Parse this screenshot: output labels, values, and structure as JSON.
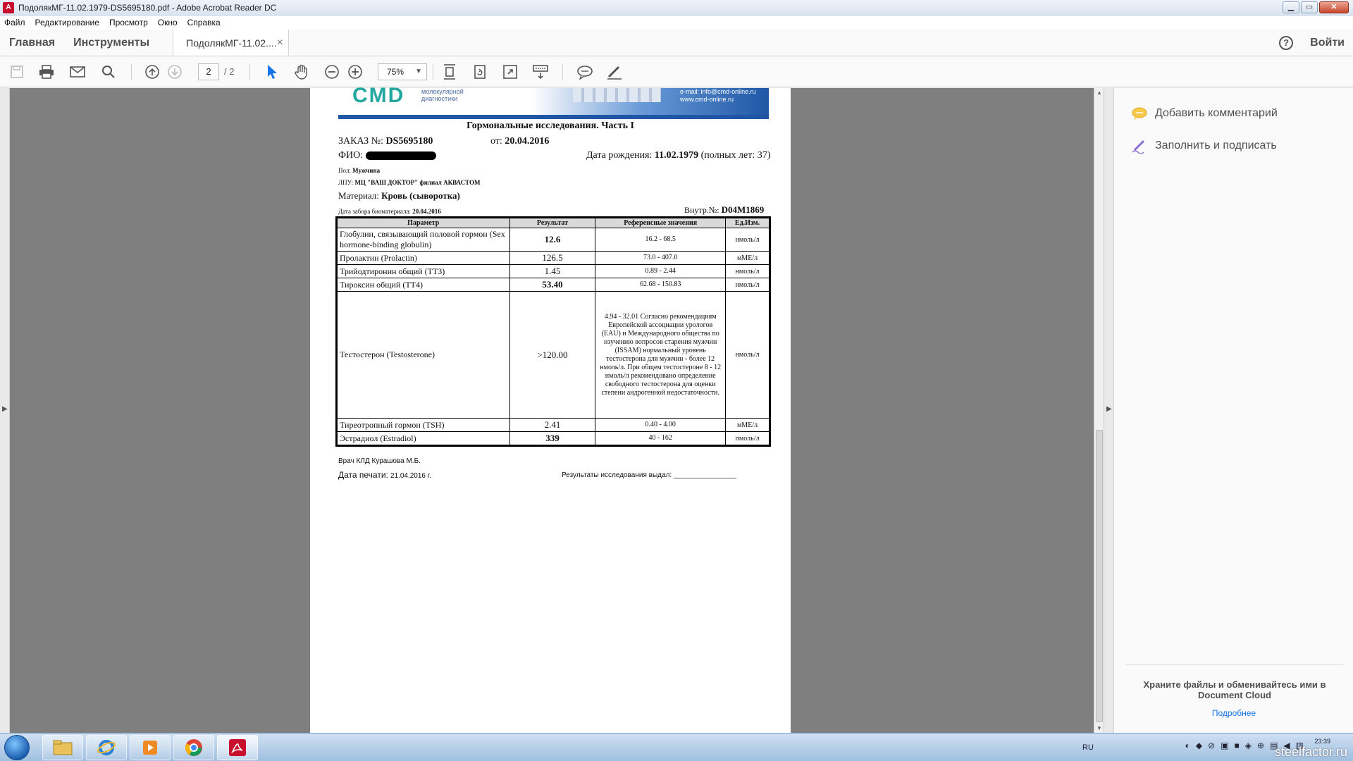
{
  "window": {
    "title": "ПодолякМГ-11.02.1979-DS5695180.pdf - Adobe Acrobat Reader DC",
    "controls": [
      "▁",
      "▭",
      "✕"
    ]
  },
  "menu": [
    "Файл",
    "Редактирование",
    "Просмотр",
    "Окно",
    "Справка"
  ],
  "tabs": {
    "home": "Главная",
    "tools": "Инструменты",
    "document": "ПодолякМГ-11.02....",
    "close": "×",
    "help": "?",
    "signin": "Войти"
  },
  "toolbar": {
    "icons": [
      "save-icon",
      "print-icon",
      "email-icon",
      "search-icon",
      "page-up-icon",
      "page-down-icon",
      "select-cursor-icon",
      "hand-icon",
      "zoom-out-icon",
      "zoom-in-icon",
      "fit-page-icon",
      "rotate-icon",
      "fullscreen-icon",
      "scroll-mode-icon",
      "comment-icon",
      "sign-icon"
    ],
    "page_current": "2",
    "page_total": "/ 2",
    "zoom": "75%"
  },
  "right_panel": {
    "add_comment": "Добавить комментарий",
    "fill_sign": "Заполнить и подписать",
    "cloud_text": "Храните файлы и обменивайтесь ими в Document Cloud",
    "more": "Подробнее"
  },
  "document": {
    "logo": "CMD",
    "logo_sub": "молекулярной диагностики",
    "contact_email": "e-mail: info@cmd-online.ru",
    "contact_site": "www.cmd-online.ru",
    "title": "Гормональные исследования. Часть I",
    "order_label": "ЗАКАЗ №:",
    "order_no": "DS5695180",
    "order_date_label": "от:",
    "order_date": "20.04.2016",
    "fio_label": "ФИО:",
    "birth_label": "Дата рождения:",
    "birth_date": "11.02.1979",
    "full_years": "(полных лет: 37)",
    "sex_label": "Пол:",
    "sex": "Мужчина",
    "lpu_label": "ЛПУ:",
    "lpu": "МЦ \"ВАШ ДОКТОР\" филиал АКВАСТОМ",
    "material_label": "Материал:",
    "material": "Кровь (сыворотка)",
    "collect_label": "Дата забора биоматериала:",
    "collect_date": "20.04.2016",
    "internal_label": "Внутр.№:",
    "internal_no": "D04M1869",
    "headers": [
      "Параметр",
      "Результат",
      "Референсные значения",
      "Ед.Изм."
    ],
    "rows": [
      {
        "param": "Глобулин, связывающий половой гормон (Sex hormone-binding globulin)",
        "result": "12.6",
        "ref": "16.2 - 68.5",
        "unit": "нмоль/л"
      },
      {
        "param": "Пролактин (Prolactin)",
        "result": "126.5",
        "ref": "73.0 - 407.0",
        "unit": "мМЕ/л"
      },
      {
        "param": "Трийодтиронин общий (ТТ3)",
        "result": "1.45",
        "ref": "0.89 - 2.44",
        "unit": "нмоль/л"
      },
      {
        "param": "Тироксин общий (ТТ4)",
        "result": "53.40",
        "ref": "62.68 - 150.83",
        "unit": "нмоль/л"
      },
      {
        "param": "Тестостерон (Testosterone)",
        "result": ">120.00",
        "ref": "4.94 - 32.01 Согласно рекомендациям Европейской ассоциации урологов (EAU) и Международного общества по изучению вопросов старения мужчин (ISSAM) нормальный уровень тестостерона для мужчин - более 12 нмоль/л. При общем тестостероне 8 - 12 нмоль/л рекомендовано определение свободного тестостерона для оценки степени андрогенной недостаточности.",
        "unit": "нмоль/л"
      },
      {
        "param": "Тиреотропный гормон (TSH)",
        "result": "2.41",
        "ref": "0.40 - 4.00",
        "unit": "мМЕ/л"
      },
      {
        "param": "Эстрадиол (Estradiol)",
        "result": "339",
        "ref": "40 - 162",
        "unit": "пмоль/л"
      }
    ],
    "doctor": "Врач КЛД Курашова М.Б.",
    "print_date_label": "Дата печати:",
    "print_date": "21.04.2016 г.",
    "issued_label": "Результаты исследования выдал: ________________"
  },
  "taskbar": {
    "apps": [
      "explorer-icon",
      "ie-icon",
      "media-player-icon",
      "chrome-icon",
      "acrobat-icon"
    ],
    "lang": "RU",
    "clock": "23:39",
    "watermark": "steelfactor.ru"
  }
}
